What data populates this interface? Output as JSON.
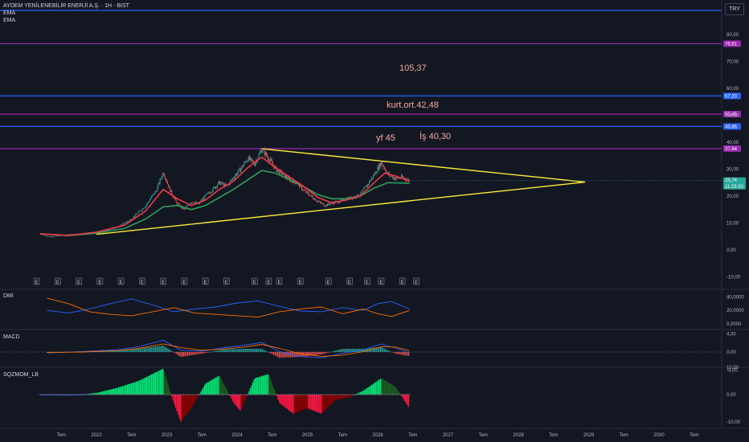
{
  "header": {
    "title": "AYDEM YENİLENEBİLİR ENERJİ A.Ş. · 1H · BIST",
    "ema1": "EMA",
    "ema2": "EMA",
    "currency": "TRY"
  },
  "annotations": {
    "a105": "105,37",
    "kurt": "kurt.ort.42,48",
    "yf": "yf 45",
    "is": "İş 40,30"
  },
  "panes": {
    "dmi": "DMI",
    "macd": "MACD",
    "sqz": "SQZMOM_LB"
  },
  "colors": {
    "background": "#131722",
    "up": "#26a69a",
    "down": "#ef5350",
    "ema_fast": "#f23645",
    "ema_slow": "#2e9e5b",
    "triangle": "#ffeb3b",
    "level_blue": "#2962ff",
    "level_purple": "#9c27b0"
  },
  "chart_data": [
    {
      "type": "line",
      "name": "price",
      "x_labels": [
        "Tem",
        "2022",
        "Tem",
        "2023",
        "Tem",
        "2024",
        "Tem",
        "2025",
        "Tem",
        "2026",
        "Tem",
        "2027",
        "Tem",
        "2028",
        "Tem",
        "2029",
        "Tem",
        "2030",
        "Tem"
      ],
      "y_ticks": [
        "80,00",
        "70,00",
        "60,00",
        "50,00",
        "40,00",
        "30,00",
        "20,00",
        "10,00",
        "0,00",
        "-10,00"
      ],
      "ylim": [
        -10,
        90
      ],
      "price_path": [
        [
          2021.2,
          6.0
        ],
        [
          2021.35,
          4.8
        ],
        [
          2021.5,
          5.5
        ],
        [
          2021.7,
          5.8
        ],
        [
          2021.9,
          6.2
        ],
        [
          2022.1,
          7.0
        ],
        [
          2022.3,
          8.5
        ],
        [
          2022.5,
          11.5
        ],
        [
          2022.7,
          16.5
        ],
        [
          2022.85,
          22.0
        ],
        [
          2022.95,
          29.0
        ],
        [
          2023.05,
          22.0
        ],
        [
          2023.15,
          17.0
        ],
        [
          2023.25,
          15.0
        ],
        [
          2023.35,
          18.0
        ],
        [
          2023.45,
          17.0
        ],
        [
          2023.55,
          20.0
        ],
        [
          2023.65,
          22.5
        ],
        [
          2023.75,
          25.0
        ],
        [
          2023.85,
          23.5
        ],
        [
          2023.95,
          27.0
        ],
        [
          2024.05,
          30.0
        ],
        [
          2024.15,
          34.0
        ],
        [
          2024.25,
          32.0
        ],
        [
          2024.35,
          37.5
        ],
        [
          2024.45,
          34.0
        ],
        [
          2024.55,
          30.0
        ],
        [
          2024.65,
          28.0
        ],
        [
          2024.75,
          26.0
        ],
        [
          2024.85,
          25.0
        ],
        [
          2024.95,
          22.0
        ],
        [
          2025.05,
          20.0
        ],
        [
          2025.15,
          18.0
        ],
        [
          2025.25,
          16.5
        ],
        [
          2025.35,
          17.5
        ],
        [
          2025.45,
          18.0
        ],
        [
          2025.55,
          19.0
        ],
        [
          2025.65,
          19.5
        ],
        [
          2025.75,
          20.5
        ],
        [
          2025.85,
          24.0
        ],
        [
          2025.95,
          28.0
        ],
        [
          2026.05,
          32.5
        ],
        [
          2026.15,
          28.0
        ],
        [
          2026.25,
          26.5
        ],
        [
          2026.35,
          27.0
        ],
        [
          2026.45,
          25.74
        ]
      ],
      "ema_fast": [
        [
          2021.2,
          6.0
        ],
        [
          2021.6,
          5.4
        ],
        [
          2022.0,
          6.6
        ],
        [
          2022.4,
          9.2
        ],
        [
          2022.7,
          14.5
        ],
        [
          2022.95,
          22.5
        ],
        [
          2023.15,
          19.0
        ],
        [
          2023.35,
          16.5
        ],
        [
          2023.55,
          18.5
        ],
        [
          2023.75,
          22.5
        ],
        [
          2023.95,
          25.5
        ],
        [
          2024.15,
          30.5
        ],
        [
          2024.35,
          34.5
        ],
        [
          2024.55,
          30.5
        ],
        [
          2024.75,
          27.0
        ],
        [
          2024.95,
          23.5
        ],
        [
          2025.15,
          19.5
        ],
        [
          2025.35,
          17.5
        ],
        [
          2025.55,
          18.5
        ],
        [
          2025.75,
          20.0
        ],
        [
          2025.95,
          25.0
        ],
        [
          2026.1,
          28.5
        ],
        [
          2026.25,
          27.5
        ],
        [
          2026.45,
          25.5
        ]
      ],
      "ema_slow": [
        [
          2021.2,
          6.0
        ],
        [
          2021.6,
          5.3
        ],
        [
          2022.0,
          6.2
        ],
        [
          2022.4,
          8.0
        ],
        [
          2022.7,
          11.5
        ],
        [
          2022.95,
          16.0
        ],
        [
          2023.15,
          16.5
        ],
        [
          2023.35,
          15.0
        ],
        [
          2023.55,
          16.5
        ],
        [
          2023.75,
          19.5
        ],
        [
          2023.95,
          22.5
        ],
        [
          2024.15,
          26.0
        ],
        [
          2024.35,
          29.5
        ],
        [
          2024.55,
          28.5
        ],
        [
          2024.75,
          26.0
        ],
        [
          2024.95,
          23.5
        ],
        [
          2025.15,
          20.5
        ],
        [
          2025.35,
          19.0
        ],
        [
          2025.55,
          19.0
        ],
        [
          2025.75,
          20.0
        ],
        [
          2025.95,
          23.0
        ],
        [
          2026.15,
          25.0
        ],
        [
          2026.45,
          24.8
        ]
      ],
      "levels": [
        {
          "value": 89.0,
          "color": "#2962ff"
        },
        {
          "value": 76.61,
          "label": "76,61",
          "color": "#9c27b0"
        },
        {
          "value": 57.2,
          "label": "57,20",
          "color": "#2962ff"
        },
        {
          "value": 50.45,
          "label": "50,45",
          "color": "#9c27b0"
        },
        {
          "value": 45.86,
          "label": "45,86",
          "color": "#2962ff"
        },
        {
          "value": 37.64,
          "label": "37,64",
          "color": "#9c27b0"
        }
      ],
      "last_price": "25,74",
      "countdown": "11:23:20",
      "triangle": {
        "upper": [
          [
            2024.35,
            37.6
          ],
          [
            2028.95,
            25.2
          ]
        ],
        "lower": [
          [
            2022.0,
            5.8
          ],
          [
            2028.95,
            25.2
          ]
        ]
      },
      "events": [
        2021.15,
        2021.45,
        2021.75,
        2022.05,
        2022.35,
        2022.65,
        2022.95,
        2023.25,
        2023.55,
        2023.85,
        2024.25,
        2024.45,
        2024.6,
        2024.9,
        2025.3,
        2025.6,
        2025.85,
        2026.05,
        2026.35,
        2026.55
      ]
    },
    {
      "type": "line",
      "name": "DMI",
      "y_ticks": [
        "40,0000",
        "20,0000",
        "0,0000"
      ],
      "ylim": [
        0,
        45
      ],
      "series": [
        {
          "color": "#2962ff",
          "values": [
            [
              2021.3,
              20
            ],
            [
              2021.6,
              16
            ],
            [
              2021.9,
              22
            ],
            [
              2022.2,
              30
            ],
            [
              2022.5,
              37
            ],
            [
              2022.8,
              28
            ],
            [
              2023.1,
              18
            ],
            [
              2023.4,
              22
            ],
            [
              2023.7,
              25
            ],
            [
              2024.0,
              31
            ],
            [
              2024.3,
              34
            ],
            [
              2024.6,
              26
            ],
            [
              2024.9,
              19
            ],
            [
              2025.2,
              18
            ],
            [
              2025.5,
              24
            ],
            [
              2025.8,
              20
            ],
            [
              2026.0,
              30
            ],
            [
              2026.2,
              33
            ],
            [
              2026.45,
              22
            ]
          ]
        },
        {
          "color": "#ff6d00",
          "values": [
            [
              2021.3,
              38
            ],
            [
              2021.6,
              30
            ],
            [
              2021.9,
              18
            ],
            [
              2022.2,
              14
            ],
            [
              2022.5,
              12
            ],
            [
              2022.8,
              18
            ],
            [
              2023.1,
              24
            ],
            [
              2023.4,
              16
            ],
            [
              2023.7,
              14
            ],
            [
              2024.0,
              12
            ],
            [
              2024.3,
              10
            ],
            [
              2024.6,
              18
            ],
            [
              2024.9,
              22
            ],
            [
              2025.2,
              25
            ],
            [
              2025.5,
              15
            ],
            [
              2025.8,
              22
            ],
            [
              2026.0,
              15
            ],
            [
              2026.2,
              11
            ],
            [
              2026.45,
              20
            ]
          ]
        }
      ]
    },
    {
      "type": "bar",
      "name": "MACD",
      "y_ticks": [
        "4,00",
        "0,00",
        "-4,00"
      ],
      "ylim": [
        -5,
        5
      ],
      "macd": [
        [
          2021.3,
          -0.2
        ],
        [
          2021.8,
          0.1
        ],
        [
          2022.3,
          0.5
        ],
        [
          2022.6,
          1.2
        ],
        [
          2022.95,
          2.6
        ],
        [
          2023.2,
          0.4
        ],
        [
          2023.5,
          0.2
        ],
        [
          2023.8,
          0.9
        ],
        [
          2024.1,
          1.5
        ],
        [
          2024.35,
          2.1
        ],
        [
          2024.6,
          0.1
        ],
        [
          2024.9,
          -1.0
        ],
        [
          2025.2,
          -1.3
        ],
        [
          2025.5,
          -0.3
        ],
        [
          2025.8,
          0.5
        ],
        [
          2026.05,
          1.8
        ],
        [
          2026.25,
          0.9
        ],
        [
          2026.45,
          -0.2
        ]
      ],
      "signal": [
        [
          2021.3,
          -0.1
        ],
        [
          2021.8,
          0.0
        ],
        [
          2022.3,
          0.3
        ],
        [
          2022.6,
          0.8
        ],
        [
          2022.95,
          1.8
        ],
        [
          2023.2,
          1.0
        ],
        [
          2023.5,
          0.4
        ],
        [
          2023.8,
          0.6
        ],
        [
          2024.1,
          1.1
        ],
        [
          2024.35,
          1.7
        ],
        [
          2024.6,
          0.8
        ],
        [
          2024.9,
          -0.4
        ],
        [
          2025.2,
          -1.0
        ],
        [
          2025.5,
          -0.7
        ],
        [
          2025.8,
          0.1
        ],
        [
          2026.05,
          1.2
        ],
        [
          2026.25,
          1.1
        ],
        [
          2026.45,
          0.3
        ]
      ]
    },
    {
      "type": "bar",
      "name": "SQZMOM_LB",
      "y_ticks": [
        "10,00",
        "0,00",
        "-10,00"
      ],
      "ylim": [
        -12,
        12
      ],
      "momentum": [
        [
          2021.2,
          0
        ],
        [
          2021.6,
          -0.4
        ],
        [
          2022.0,
          0.6
        ],
        [
          2022.3,
          2.5
        ],
        [
          2022.6,
          5
        ],
        [
          2022.95,
          9.5
        ],
        [
          2023.1,
          -3
        ],
        [
          2023.2,
          -10
        ],
        [
          2023.35,
          -5
        ],
        [
          2023.55,
          4
        ],
        [
          2023.75,
          7
        ],
        [
          2023.95,
          -3
        ],
        [
          2024.05,
          -6
        ],
        [
          2024.25,
          6
        ],
        [
          2024.45,
          7.5
        ],
        [
          2024.6,
          -3
        ],
        [
          2024.8,
          -7
        ],
        [
          2025.0,
          -5
        ],
        [
          2025.2,
          -7
        ],
        [
          2025.4,
          -2
        ],
        [
          2025.6,
          -1
        ],
        [
          2025.8,
          1.5
        ],
        [
          2026.05,
          6
        ],
        [
          2026.25,
          3
        ],
        [
          2026.45,
          -5
        ]
      ]
    }
  ]
}
